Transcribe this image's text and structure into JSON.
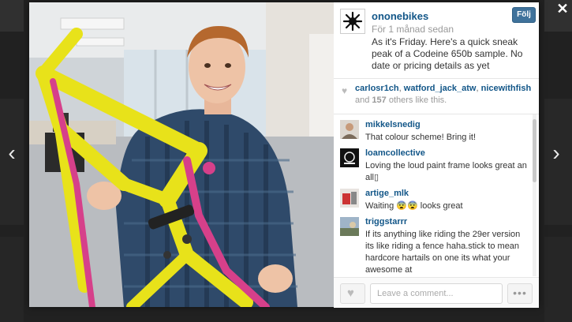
{
  "post": {
    "username": "ononebikes",
    "time_ago": "För 1 månad sedan",
    "caption": "As it's Friday. Here's a quick sneak peak of a Codeine 650b sample. No date or pricing details as yet",
    "follow_label": "Följ"
  },
  "likes": {
    "likers": [
      "carlosr1ch",
      "watford_jack_atw",
      "nicewithfish"
    ],
    "separator": ",",
    "others_prefix": "and",
    "others_count": "157",
    "others_suffix": "others like this."
  },
  "comments": [
    {
      "user": "mikkelsnedig",
      "text": "That colour scheme! Bring it!"
    },
    {
      "user": "loamcollective",
      "text": "Loving the loud paint frame looks great an all▯"
    },
    {
      "user": "artige_mlk",
      "text": "Waiting 😨😨 looks great"
    },
    {
      "user": "triggstarrr",
      "text": "If its anything like riding the 29er version its like riding a fence haha.stick to mean hardcore hartails on one its what your awesome at"
    }
  ],
  "footer": {
    "comment_placeholder": "Leave a comment...",
    "more_label": "•••"
  },
  "icons": {
    "close": "close-icon",
    "prev": "chevron-left-icon",
    "next": "chevron-right-icon",
    "heart": "heart-icon"
  },
  "colors": {
    "link": "#125688",
    "follow_button": "#3f729b",
    "frame_yellow": "#e8e21a",
    "frame_pink": "#d6408a",
    "shirt": "#2f4a6a"
  }
}
